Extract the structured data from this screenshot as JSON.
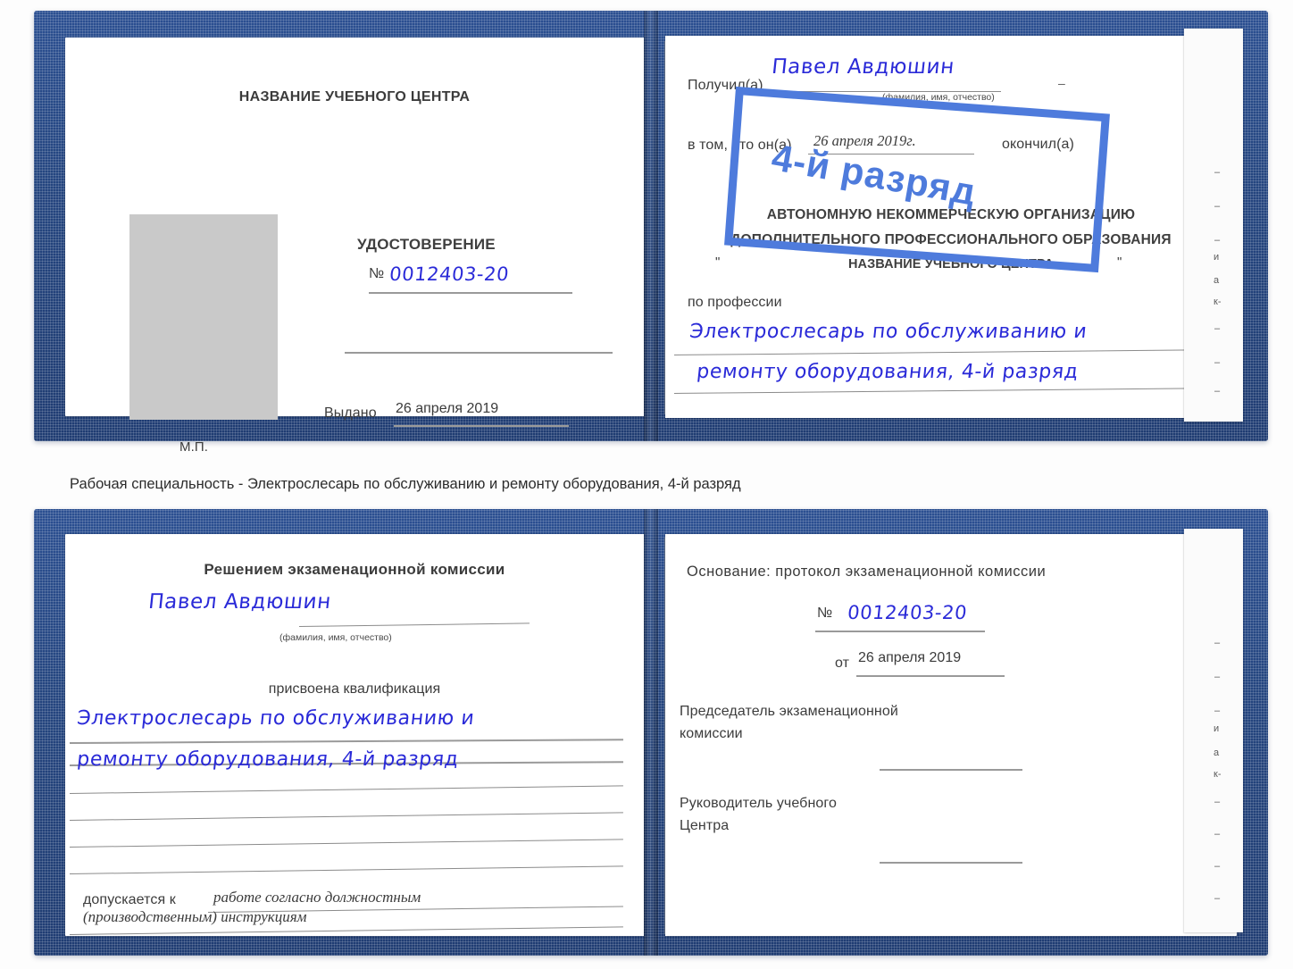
{
  "caption": {
    "text": "Рабочая специальность - Электрослесарь по обслуживанию и ремонту оборудования, 4-й разряд"
  },
  "colors": {
    "cover_blue": "#24457f",
    "handwriting_blue": "#2a2ad8",
    "stamp_blue": "#4e7bdc",
    "photo_gray": "#c9c9c9",
    "rule_gray": "#8b8b8b",
    "page_white": "#ffffff"
  },
  "certificate_top": {
    "left_page": {
      "center_name": "НАЗВАНИЕ УЧЕБНОГО ЦЕНТРА",
      "photo_placeholder": "photo-placeholder",
      "doc_type": "УДОСТОВЕРЕНИЕ",
      "number_symbol": "№",
      "number_value": "0012403-20",
      "issued_label": "Выдано",
      "issued_value": "26 апреля 2019",
      "seal_label": "М.П."
    },
    "right_page": {
      "received_label": "Получил(а)",
      "received_value": "Павел Авдюшин",
      "fio_hint": "(фамилия, имя, отчество)",
      "in_that_label": "в том, что он(а)",
      "date_value": "26 апреля 2019г.",
      "finished_label": "окончил(а)",
      "org_line1": "АВТОНОМНУЮ НЕКОММЕРЧЕСКУЮ ОРГАНИЗАЦИЮ",
      "org_line2": "ДОПОЛНИТЕЛЬНОГО ПРОФЕССИОНАЛЬНОГО ОБРАЗОВАНИЯ",
      "org_quote_open": "\"",
      "org_line3": "НАЗВАНИЕ УЧЕБНОГО ЦЕНТРА",
      "org_quote_close": "\"",
      "profession_label": "по профессии",
      "profession_line1": "Электрослесарь по обслуживанию и",
      "profession_line2": "ремонту оборудования, 4-й разряд"
    },
    "stamp": {
      "text": "4-й разряд"
    },
    "edge_fragments": [
      "—",
      "—",
      "—",
      "и",
      "а",
      "к-",
      "—",
      "—",
      "—",
      "—"
    ]
  },
  "certificate_bottom": {
    "left_page": {
      "title": "Решением экзаменационной комиссии",
      "name_value": "Павел Авдюшин",
      "fio_hint": "(фамилия, имя, отчество)",
      "qualification_label": "присвоена квалификация",
      "qualification_line1": "Электрослесарь по обслуживанию и",
      "qualification_line2": "ремонту оборудования, 4-й разряд",
      "admitted_label": "допускается к",
      "admitted_value_line1": "работе согласно должностным",
      "admitted_value_line2": "(производственным) инструкциям"
    },
    "right_page": {
      "basis_label": "Основание: протокол экзаменационной комиссии",
      "number_symbol": "№",
      "number_value": "0012403-20",
      "from_label": "от",
      "from_value": "26 апреля 2019",
      "chairman_line1": "Председатель экзаменационной",
      "chairman_line2": "комиссии",
      "head_line1": "Руководитель учебного",
      "head_line2": "Центра"
    },
    "edge_fragments": [
      "—",
      "—",
      "—",
      "и",
      "а",
      "к-",
      "—",
      "—",
      "—",
      "—"
    ]
  }
}
